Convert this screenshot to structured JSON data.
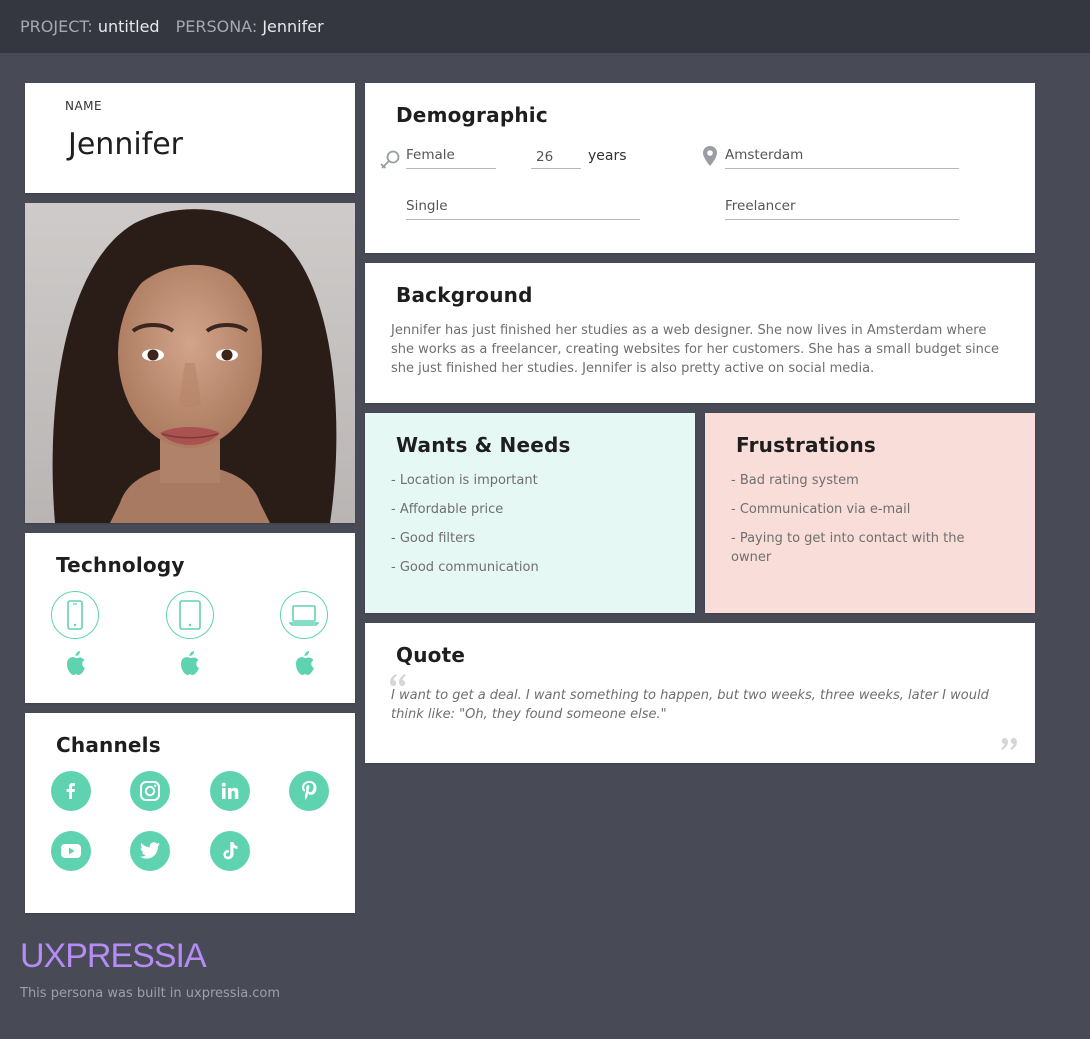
{
  "header": {
    "project_key": "PROJECT:",
    "project_value": "untitled",
    "persona_key": "PERSONA:",
    "persona_value": "Jennifer"
  },
  "name_card": {
    "label": "NAME",
    "value": "Jennifer"
  },
  "demographic": {
    "title": "Demographic",
    "gender": "Female",
    "age": "26",
    "age_unit": "years",
    "location": "Amsterdam",
    "status": "Single",
    "occupation": "Freelancer"
  },
  "background": {
    "title": "Background",
    "text": "Jennifer has just finished her studies as a web designer. She now lives in Amsterdam where she works as a freelancer, creating websites for her customers. She has a small budget since she just finished her studies. Jennifer is also pretty active on social media."
  },
  "wants": {
    "title": "Wants & Needs",
    "items": [
      "- Location is important",
      "- Affordable price",
      "- Good filters",
      "- Good communication"
    ]
  },
  "frustrations": {
    "title": "Frustrations",
    "items": [
      "- Bad rating system",
      "- Communication via e-mail",
      "- Paying to get into contact with the owner"
    ]
  },
  "quote": {
    "title": "Quote",
    "text": "I want to get a deal. I want something to happen, but two weeks, three weeks, later I would think like: \"Oh, they found someone else.\""
  },
  "technology": {
    "title": "Technology",
    "devices": [
      "mobile-phone-icon",
      "tablet-icon",
      "laptop-icon"
    ],
    "os": [
      "apple-icon",
      "apple-icon",
      "apple-icon"
    ]
  },
  "channels": {
    "title": "Channels",
    "items": [
      "facebook-icon",
      "instagram-icon",
      "linkedin-icon",
      "pinterest-icon",
      "youtube-icon",
      "twitter-icon",
      "tiktok-icon"
    ]
  },
  "footer": {
    "logo": "UXPRESSIA",
    "note": "This persona was built in uxpressia.com"
  },
  "colors": {
    "accent": "#5fd3b0",
    "wants_bg": "#e6f8f4",
    "frustrations_bg": "#f9ddd9",
    "logo": "#b58bf5",
    "page_bg": "#484b55",
    "topbar_bg": "#353740"
  }
}
